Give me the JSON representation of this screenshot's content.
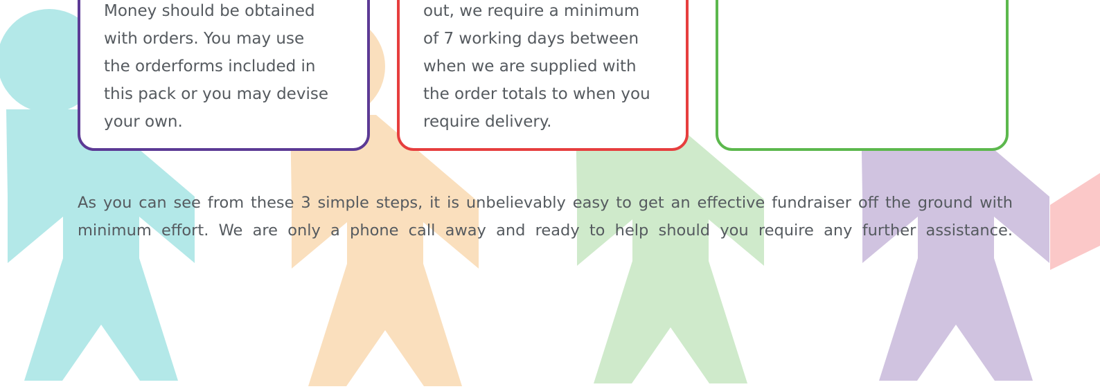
{
  "colors": {
    "figure_teal": "#b3e8e8",
    "figure_peach": "#fadfbd",
    "figure_green": "#cfeacb",
    "figure_lilac": "#d0c3e0",
    "figure_pink": "#fbc8c8",
    "card_purple": "#5c3a95",
    "card_red": "#e63e3e",
    "card_green": "#5cb84d",
    "text": "#555a5f"
  },
  "cards": [
    {
      "lines": [
        "Money should be obtained",
        "with orders. You may use",
        "the orderforms included in",
        "this pack or you may devise",
        "your own."
      ]
    },
    {
      "lines": [
        "out, we require a minimum",
        "of 7 working days between",
        "when we are supplied with",
        "the order totals to when you",
        "require delivery."
      ]
    },
    {
      "lines": []
    }
  ],
  "summary": "As you can see from these 3 simple steps, it is unbelievably easy to get an effective fundraiser off the ground with minimum effort. We are only a phone call away and ready to help should you require any further assistance."
}
